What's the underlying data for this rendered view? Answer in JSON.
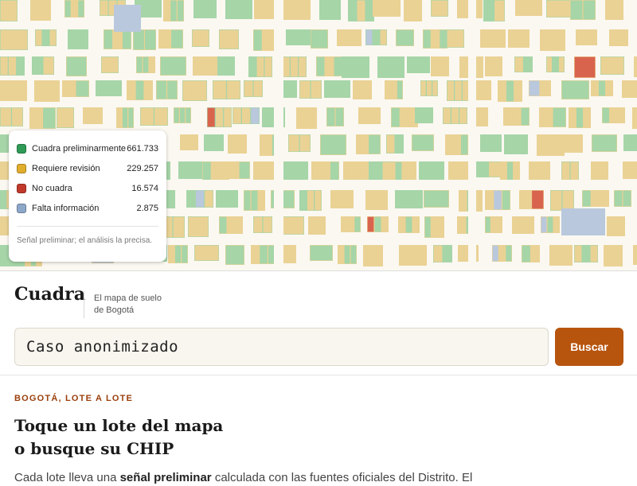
{
  "map": {
    "colors": {
      "background": "#efe6d2",
      "roads": "#fbf8f1",
      "green": "#a6d5a8",
      "yellow": "#ead295",
      "blue": "#b9c8dc",
      "red": "#d9644e"
    }
  },
  "legend": {
    "items": [
      {
        "label": "Cuadra preliminarmente",
        "count": "661.733",
        "color": "#2e9a56",
        "icon": "green-square"
      },
      {
        "label": "Requiere revisión",
        "count": "229.257",
        "color": "#e0ad2c",
        "icon": "yellow-square"
      },
      {
        "label": "No cuadra",
        "count": "16.574",
        "color": "#c0392b",
        "icon": "red-square"
      },
      {
        "label": "Falta información",
        "count": "2.875",
        "color": "#8da7c9",
        "icon": "blue-square"
      }
    ],
    "note": "Señal preliminar; el análisis la precisa."
  },
  "header": {
    "brand": "Cuadra",
    "tagline_line1": "El mapa de suelo",
    "tagline_line2": "de Bogotá",
    "search_value": "Caso anonimizado",
    "search_button": "Buscar",
    "accent": "#b7540e"
  },
  "intro": {
    "eyebrow": "BOGOTÁ, LOTE A LOTE",
    "headline_line1": "Toque un lote del mapa",
    "headline_line2": "o busque su CHIP",
    "body_pre": "Cada lote lleva una ",
    "body_bold": "señal preliminar",
    "body_post": " calculada con las fuentes oficiales del Distrito. El"
  }
}
